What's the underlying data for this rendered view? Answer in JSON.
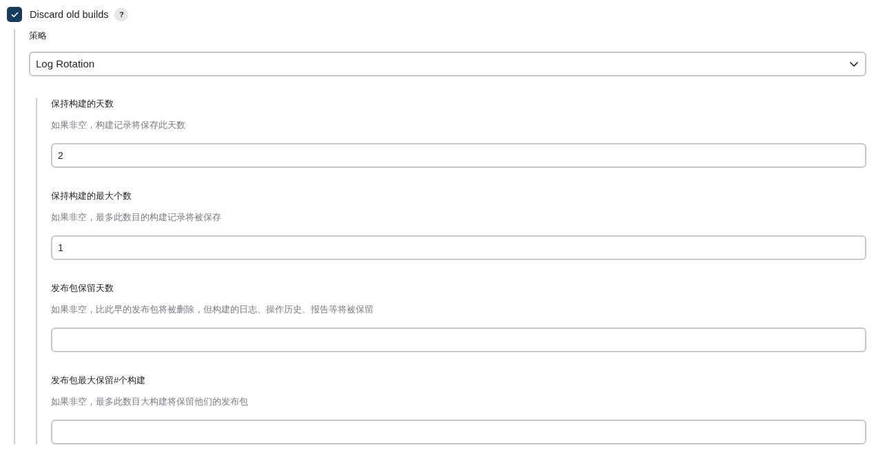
{
  "discard_old_builds": {
    "label": "Discard old builds",
    "checked": true,
    "help": "?"
  },
  "strategy": {
    "label": "策略",
    "value": "Log Rotation"
  },
  "fields": [
    {
      "label": "保持构建的天数",
      "description": "如果非空，构建记录将保存此天数",
      "value": "2"
    },
    {
      "label": "保持构建的最大个数",
      "description": "如果非空，最多此数目的构建记录将被保存",
      "value": "1"
    },
    {
      "label": "发布包保留天数",
      "description": "如果非空，比此早的发布包将被删除，但构建的日志、操作历史、报告等将被保留"
    },
    {
      "label": "发布包最大保留#个构建",
      "description": "如果非空，最多此数目大构建将保留他们的发布包"
    }
  ]
}
